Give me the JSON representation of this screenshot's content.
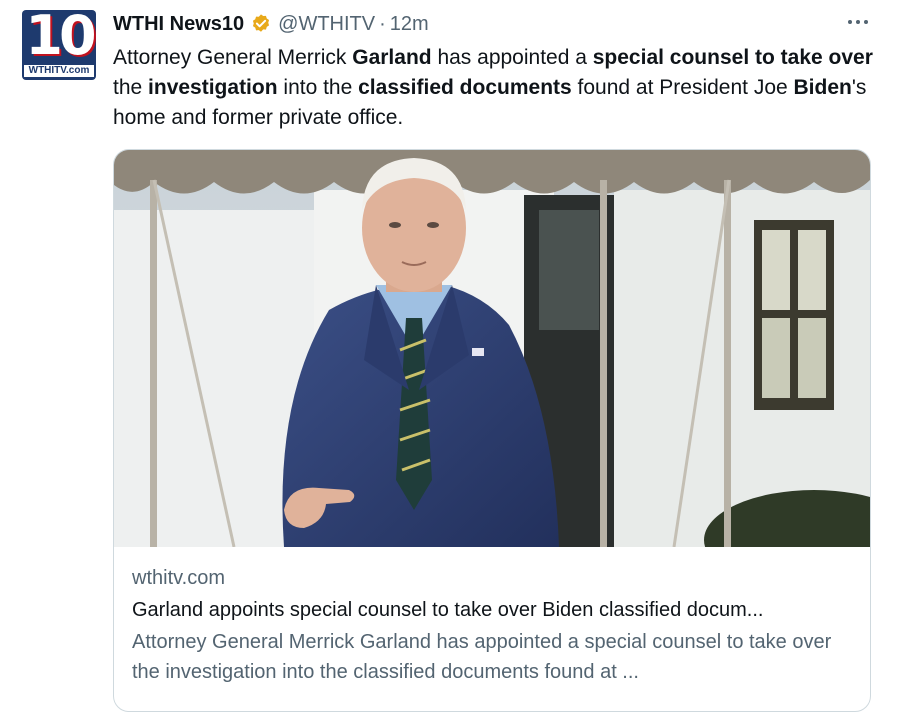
{
  "account": {
    "display_name": "WTHI News10",
    "handle": "@WTHITV",
    "separator": "·",
    "time": "12m",
    "avatar": {
      "number": "10",
      "site": "WTHITV.com"
    },
    "verified": true
  },
  "tweet": {
    "segments": [
      {
        "text": "Attorney General Merrick ",
        "bold": false
      },
      {
        "text": "Garland",
        "bold": true
      },
      {
        "text": " has appointed a ",
        "bold": false
      },
      {
        "text": "special counsel to take over",
        "bold": true
      },
      {
        "text": " the ",
        "bold": false
      },
      {
        "text": "investigation",
        "bold": true
      },
      {
        "text": " into the ",
        "bold": false
      },
      {
        "text": "classified documents",
        "bold": true
      },
      {
        "text": " found at President Joe ",
        "bold": false
      },
      {
        "text": "Biden",
        "bold": true
      },
      {
        "text": "'s home and former private office.",
        "bold": false
      }
    ]
  },
  "link_card": {
    "domain": "wthitv.com",
    "title": "Garland appoints special counsel to take over Biden classified docum...",
    "description": "Attorney General Merrick Garland has appointed a special counsel to take over the investigation into the classified documents found at ..."
  },
  "colors": {
    "text": "#0f1419",
    "secondary": "#536471",
    "verified_badge": "#e8a91a",
    "border": "#cfd9de"
  },
  "icons": {
    "verified": "verified-badge-icon",
    "more": "more-dots-icon"
  }
}
